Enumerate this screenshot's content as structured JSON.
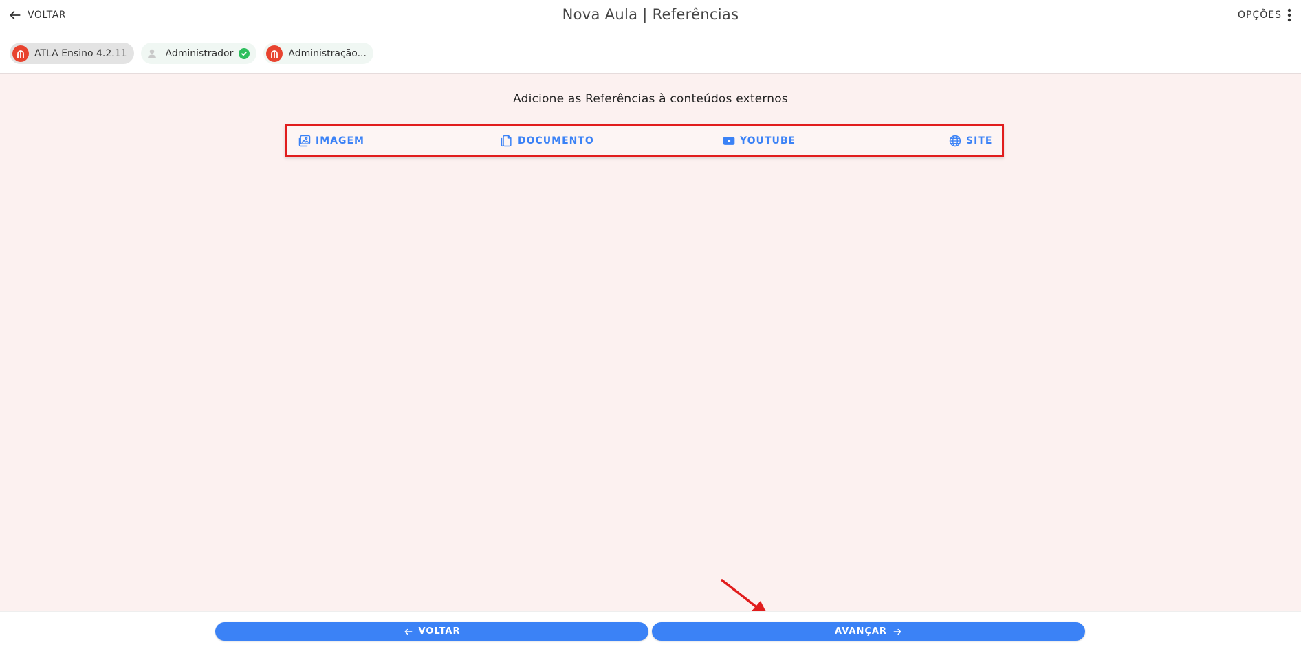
{
  "header": {
    "back_label": "VOLTAR",
    "title": "Nova Aula | Referências",
    "options_label": "OPÇÕES"
  },
  "chips": [
    {
      "label": "ATLA Ensino 4.2.11",
      "icon": "atla-logo-icon"
    },
    {
      "label": "Administrador",
      "icon": "user-avatar-icon",
      "status_icon": "check-circle-icon"
    },
    {
      "label": "Administração...",
      "icon": "atla-logo-icon"
    }
  ],
  "main": {
    "subtitle": "Adicione as Referências à conteúdos externos",
    "references": [
      {
        "label": "IMAGEM",
        "icon": "image-icon"
      },
      {
        "label": "DOCUMENTO",
        "icon": "document-icon"
      },
      {
        "label": "YOUTUBE",
        "icon": "youtube-icon"
      },
      {
        "label": "SITE",
        "icon": "globe-icon"
      }
    ]
  },
  "footer": {
    "back_label": "VOLTAR",
    "next_label": "AVANÇAR"
  },
  "colors": {
    "accent": "#3b82f6",
    "highlight": "#e11d1d",
    "content_bg": "#fcf1f0",
    "logo": "#e8432f",
    "check": "#2fbf5e"
  }
}
